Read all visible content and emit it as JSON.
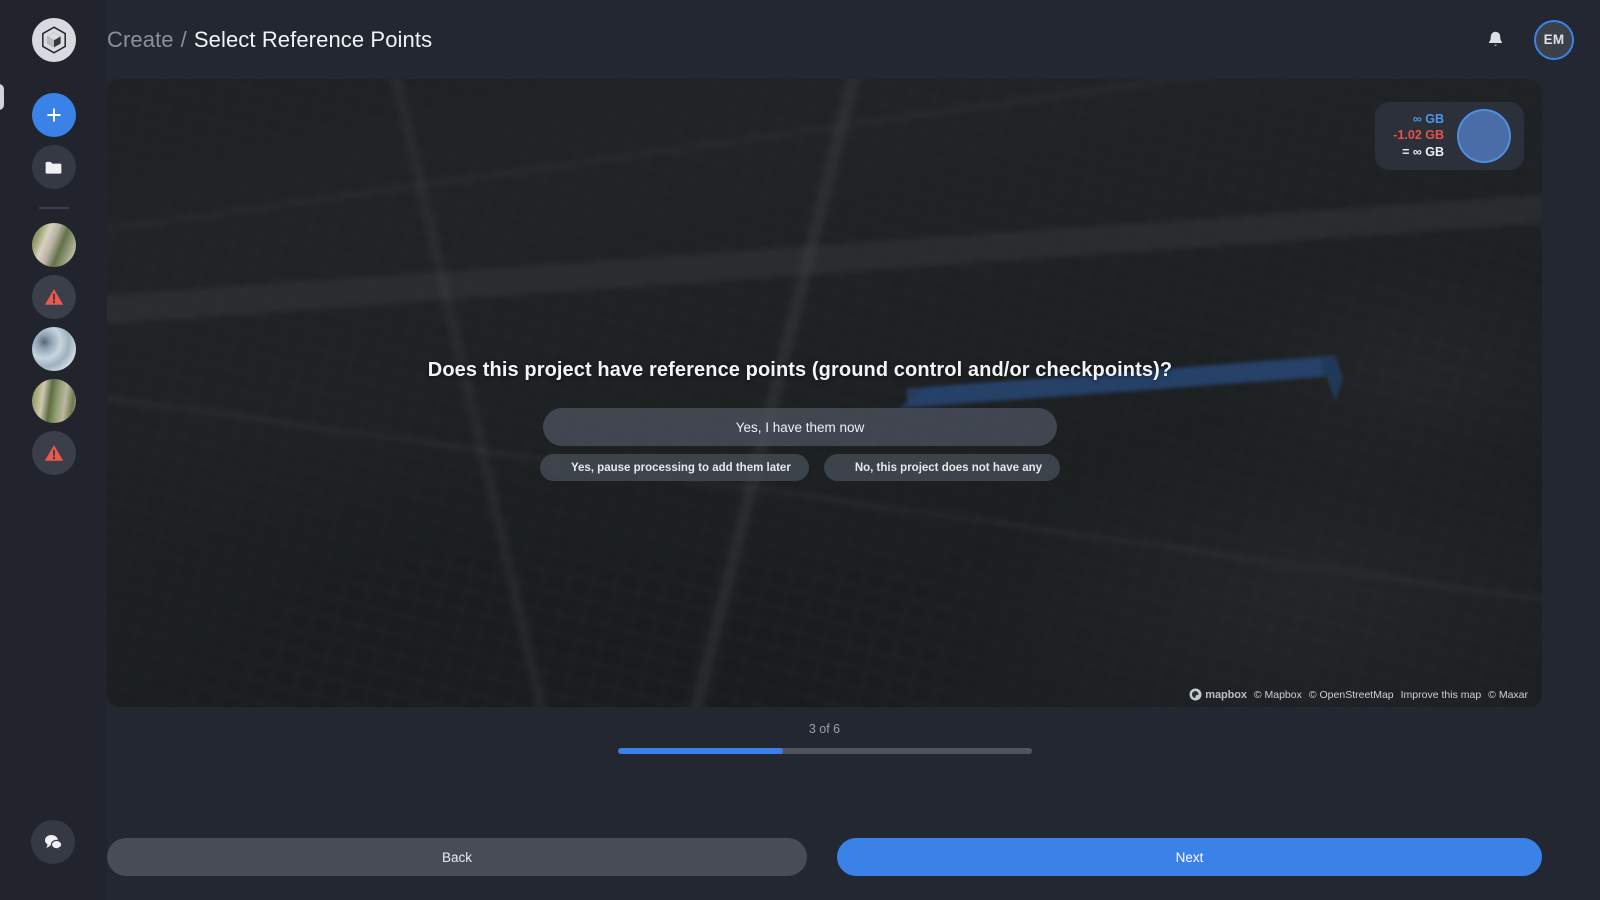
{
  "app": {
    "logo_icon": "cube-polygon-logo"
  },
  "header": {
    "breadcrumb": {
      "parent": "Create",
      "separator": "/",
      "current": "Select Reference Points"
    },
    "notifications_icon": "bell-icon",
    "avatar_initials": "EM"
  },
  "sidebar": {
    "add_icon": "plus-icon",
    "add_label": "New project",
    "folder_icon": "folder-icon",
    "folder_label": "Projects folder",
    "chat_icon": "chat-bubbles-icon",
    "chat_label": "Support chat",
    "items": [
      {
        "name": "project-thumbnail-1",
        "kind": "thumbnail",
        "thumb_class": "thumb-a"
      },
      {
        "name": "project-warning-1",
        "kind": "warning",
        "icon": "warning-triangle-icon"
      },
      {
        "name": "project-thumbnail-2",
        "kind": "thumbnail",
        "thumb_class": "thumb-b"
      },
      {
        "name": "project-thumbnail-3",
        "kind": "thumbnail",
        "thumb_class": "thumb-c"
      },
      {
        "name": "project-warning-2",
        "kind": "warning",
        "icon": "warning-triangle-icon"
      }
    ]
  },
  "map": {
    "storage": {
      "total": "∞ GB",
      "used": "-1.02 GB",
      "remaining": "= ∞ GB",
      "total_color": "#4a9ae8",
      "used_color": "#e8524a",
      "remaining_color": "#eef1f4",
      "donut_color": "#4a6da8"
    },
    "attribution": {
      "logo_text": "mapbox",
      "mapbox": "© Mapbox",
      "osm": "© OpenStreetMap",
      "improve": "Improve this map",
      "maxar": "© Maxar"
    },
    "flightpath_color": "#2f5fa8"
  },
  "prompt": {
    "question": "Does this project have reference points (ground control and/or checkpoints)?",
    "primary_option": "Yes, I have them now",
    "secondary_options": [
      "Yes, pause processing to add them later",
      "No, this project does not have any"
    ]
  },
  "progress": {
    "label": "3 of 6",
    "current_step": 3,
    "total_steps": 6,
    "percent": 40,
    "fill_color": "#3b82e8"
  },
  "footer": {
    "back_label": "Back",
    "next_label": "Next",
    "next_color": "#3b82e8"
  }
}
